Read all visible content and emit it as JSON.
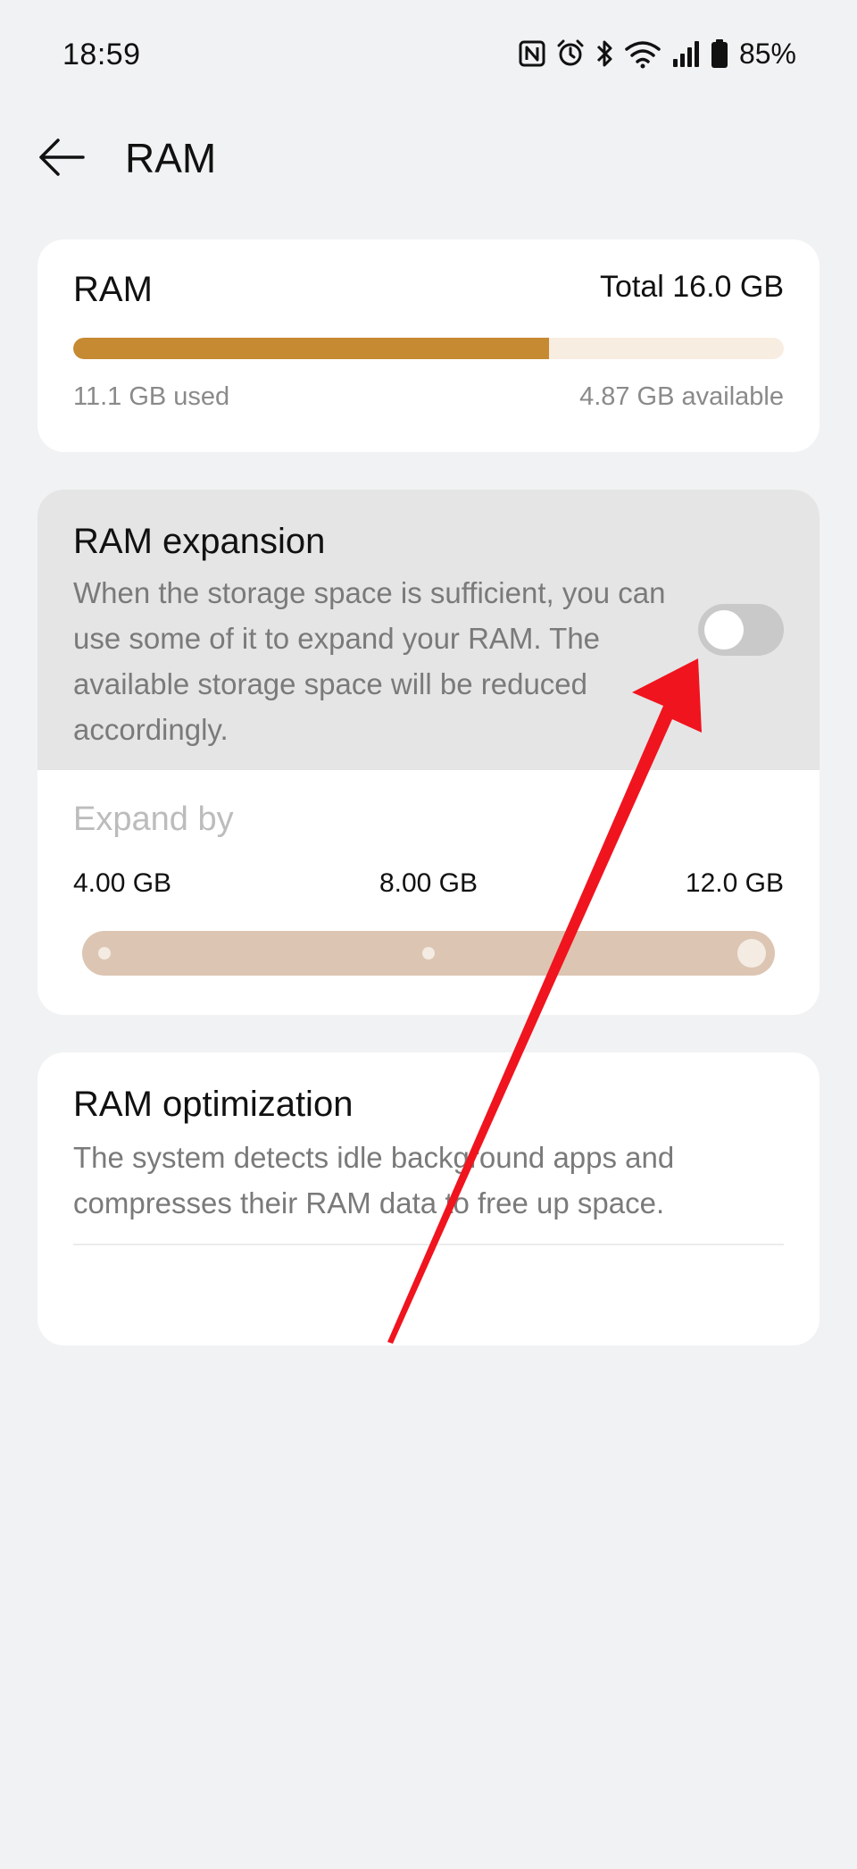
{
  "status_bar": {
    "time": "18:59",
    "battery": "85%",
    "icons": [
      "nfc-icon",
      "alarm-icon",
      "bluetooth-icon",
      "wifi-icon",
      "signal-icon",
      "battery-icon"
    ]
  },
  "header": {
    "title": "RAM",
    "back_icon": "arrow-left-icon"
  },
  "ram_card": {
    "label": "RAM",
    "total": "Total 16.0 GB",
    "used": "11.1 GB used",
    "available": "4.87 GB available",
    "usage_fraction": 0.67,
    "bar_color": "#c68a33",
    "bar_track_color": "#f8ede1"
  },
  "expansion_card": {
    "title": "RAM expansion",
    "description": "When the storage space is sufficient, you can use some of it to expand your RAM. The available storage space will be reduced accordingly.",
    "toggle_on": false,
    "expand_by_label": "Expand by",
    "options": [
      "4.00 GB",
      "8.00 GB",
      "12.0 GB"
    ],
    "selected_option": "12.0 GB"
  },
  "optimization_card": {
    "title": "RAM optimization",
    "description": "The system detects idle background apps and compresses their RAM data to free up space."
  },
  "annotation": {
    "arrow_color": "#f0141e"
  }
}
